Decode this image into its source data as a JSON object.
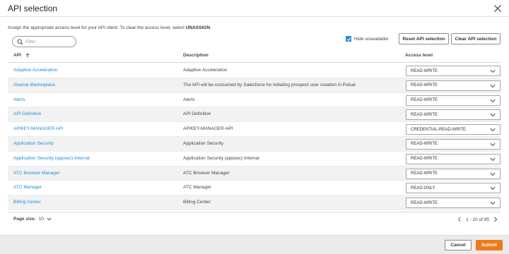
{
  "modal": {
    "title": "API selection",
    "instructions_prefix": "Assign the appropriate access level for your API client. To clear the access level, select ",
    "instructions_keyword": "UNASSIGN",
    "instructions_suffix": "."
  },
  "toolbar": {
    "filter_placeholder": "Filter",
    "hide_unavailable_label": "Hide unavailable",
    "hide_unavailable_checked": true,
    "reset_label": "Reset API selection",
    "clear_label": "Clear API selection"
  },
  "table": {
    "columns": [
      "API",
      "Description",
      "Access level"
    ],
    "sort_column": "API",
    "sort_direction": "ascending",
    "rows": [
      {
        "api": "Adaptive Acceleration",
        "description": "Adaptive Acceleration",
        "access": "READ-WRITE"
      },
      {
        "api": "Akamai Marketplace",
        "description": "The API will be consumed by Salesforce for initiating prospect user creation in Pulsar",
        "access": "READ-WRITE"
      },
      {
        "api": "Alerts",
        "description": "Alerts",
        "access": "READ-WRITE"
      },
      {
        "api": "API Definition",
        "description": "API Definition",
        "access": "READ-WRITE"
      },
      {
        "api": "APIKEY-MANAGER-API",
        "description": "APIKEY-MANAGER-API",
        "access": "CREDENTIAL-READ-WRITE"
      },
      {
        "api": "Application Security",
        "description": "Application Security",
        "access": "READ-WRITE"
      },
      {
        "api": "Application Security (appsec) Internal",
        "description": "Application Security (appsec) Internal",
        "access": "READ-WRITE"
      },
      {
        "api": "ATC Browser Manager",
        "description": "ATC Browser Manager",
        "access": "READ-WRITE"
      },
      {
        "api": "ATC Manager",
        "description": "ATC Manager",
        "access": "READ-ONLY"
      },
      {
        "api": "Billing Center",
        "description": "Billing Center",
        "access": "READ-WRITE"
      }
    ]
  },
  "pager": {
    "page_size_label": "Page size:",
    "page_size_value": "10",
    "range_text": "1 - 10 of 85"
  },
  "footer": {
    "cancel_label": "Cancel",
    "submit_label": "Submit"
  },
  "colors": {
    "link": "#1f8dd6",
    "checkbox": "#2a8dd4",
    "submit": "#ee7b1b",
    "footer_bg": "#ebebeb",
    "row_alt": "#f2f2f2"
  },
  "icons": {
    "close": "close-icon",
    "search": "search-icon",
    "check": "checkmark-icon",
    "sort": "sort-arrow-up-icon",
    "dropdown": "chevron-down-icon",
    "prev": "chevron-left-icon",
    "next": "chevron-right-icon"
  }
}
